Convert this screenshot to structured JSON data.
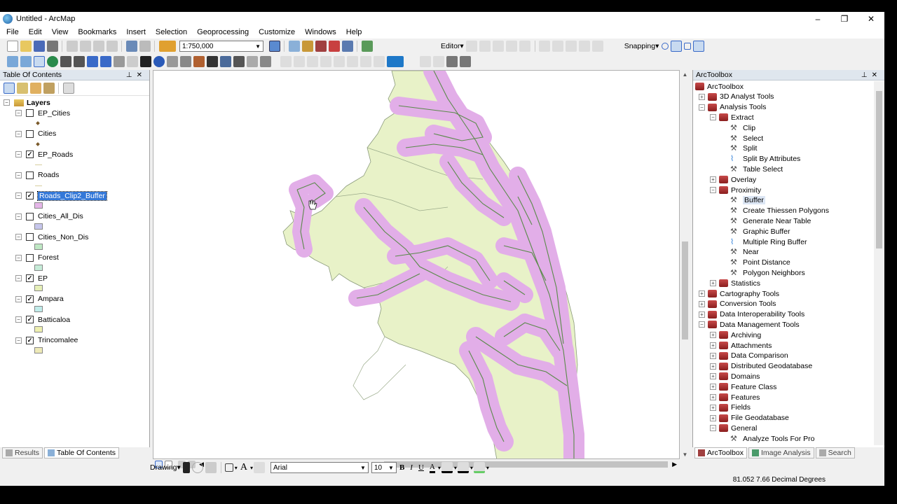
{
  "window": {
    "title": "Untitled - ArcMap",
    "minimize": "–",
    "maximize": "❐",
    "close": "✕"
  },
  "menu": [
    "File",
    "Edit",
    "View",
    "Bookmarks",
    "Insert",
    "Selection",
    "Geoprocessing",
    "Customize",
    "Windows",
    "Help"
  ],
  "toolbar": {
    "scale": "1:750,000",
    "editor": "Editor▾",
    "snapping": "Snapping▾"
  },
  "toc": {
    "title": "Table Of Contents",
    "root": "Layers",
    "layers": [
      {
        "name": "EP_Cities",
        "checked": false,
        "symbol": "point"
      },
      {
        "name": "Cities",
        "checked": false,
        "symbol": "point"
      },
      {
        "name": "EP_Roads",
        "checked": true,
        "symbol": "line"
      },
      {
        "name": "Roads",
        "checked": false,
        "symbol": "line"
      },
      {
        "name": "Roads_Clip2_Buffer",
        "checked": true,
        "symbol": "fill",
        "color": "#e5b6e8",
        "selected": true
      },
      {
        "name": "Cities_All_Dis",
        "checked": false,
        "symbol": "fill",
        "color": "#c6c6ec"
      },
      {
        "name": "Cities_Non_Dis",
        "checked": false,
        "symbol": "fill",
        "color": "#bfe8c4"
      },
      {
        "name": "Forest",
        "checked": false,
        "symbol": "fill",
        "color": "#c6ecd8"
      },
      {
        "name": "EP",
        "checked": true,
        "symbol": "fill",
        "color": "#e6f0b8"
      },
      {
        "name": "Ampara",
        "checked": true,
        "symbol": "fill",
        "color": "#c0ecea"
      },
      {
        "name": "Batticaloa",
        "checked": true,
        "symbol": "fill",
        "color": "#eef0b0"
      },
      {
        "name": "Trincomalee",
        "checked": true,
        "symbol": "fill",
        "color": "#eeeab8"
      }
    ]
  },
  "arctoolbox": {
    "title": "ArcToolbox",
    "nodes": [
      {
        "label": "ArcToolbox",
        "level": 0,
        "type": "root"
      },
      {
        "label": "3D Analyst Tools",
        "level": 1,
        "type": "toolbox",
        "expander": "+"
      },
      {
        "label": "Analysis Tools",
        "level": 1,
        "type": "toolbox",
        "expander": "−"
      },
      {
        "label": "Extract",
        "level": 2,
        "type": "toolset",
        "expander": "−"
      },
      {
        "label": "Clip",
        "level": 3,
        "type": "tool"
      },
      {
        "label": "Select",
        "level": 3,
        "type": "tool"
      },
      {
        "label": "Split",
        "level": 3,
        "type": "tool"
      },
      {
        "label": "Split By Attributes",
        "level": 3,
        "type": "script"
      },
      {
        "label": "Table Select",
        "level": 3,
        "type": "tool"
      },
      {
        "label": "Overlay",
        "level": 2,
        "type": "toolset",
        "expander": "+"
      },
      {
        "label": "Proximity",
        "level": 2,
        "type": "toolset",
        "expander": "−"
      },
      {
        "label": "Buffer",
        "level": 3,
        "type": "tool",
        "selected": true
      },
      {
        "label": "Create Thiessen Polygons",
        "level": 3,
        "type": "tool"
      },
      {
        "label": "Generate Near Table",
        "level": 3,
        "type": "tool"
      },
      {
        "label": "Graphic Buffer",
        "level": 3,
        "type": "tool"
      },
      {
        "label": "Multiple Ring Buffer",
        "level": 3,
        "type": "script"
      },
      {
        "label": "Near",
        "level": 3,
        "type": "tool"
      },
      {
        "label": "Point Distance",
        "level": 3,
        "type": "tool"
      },
      {
        "label": "Polygon Neighbors",
        "level": 3,
        "type": "tool"
      },
      {
        "label": "Statistics",
        "level": 2,
        "type": "toolset",
        "expander": "+"
      },
      {
        "label": "Cartography Tools",
        "level": 1,
        "type": "toolbox",
        "expander": "+"
      },
      {
        "label": "Conversion Tools",
        "level": 1,
        "type": "toolbox",
        "expander": "+"
      },
      {
        "label": "Data Interoperability Tools",
        "level": 1,
        "type": "toolbox",
        "expander": "+"
      },
      {
        "label": "Data Management Tools",
        "level": 1,
        "type": "toolbox",
        "expander": "−"
      },
      {
        "label": "Archiving",
        "level": 2,
        "type": "toolset",
        "expander": "+"
      },
      {
        "label": "Attachments",
        "level": 2,
        "type": "toolset",
        "expander": "+"
      },
      {
        "label": "Data Comparison",
        "level": 2,
        "type": "toolset",
        "expander": "+"
      },
      {
        "label": "Distributed Geodatabase",
        "level": 2,
        "type": "toolset",
        "expander": "+"
      },
      {
        "label": "Domains",
        "level": 2,
        "type": "toolset",
        "expander": "+"
      },
      {
        "label": "Feature Class",
        "level": 2,
        "type": "toolset",
        "expander": "+"
      },
      {
        "label": "Features",
        "level": 2,
        "type": "toolset",
        "expander": "+"
      },
      {
        "label": "Fields",
        "level": 2,
        "type": "toolset",
        "expander": "+"
      },
      {
        "label": "File Geodatabase",
        "level": 2,
        "type": "toolset",
        "expander": "+"
      },
      {
        "label": "General",
        "level": 2,
        "type": "toolset",
        "expander": "−"
      },
      {
        "label": "Analyze Tools For Pro",
        "level": 3,
        "type": "tool"
      }
    ]
  },
  "left_tabs": [
    "Results",
    "Table Of Contents"
  ],
  "right_tabs": [
    "ArcToolbox",
    "Image Analysis",
    "Search"
  ],
  "drawing": {
    "label": "Drawing▾",
    "font": "Arial",
    "size": "10",
    "bold": "B",
    "italic": "I",
    "underline": "U",
    "font_color": "A"
  },
  "status": {
    "coordinates": "81.052  7.66 Decimal Degrees"
  },
  "map": {
    "land_color": "#e8f2c8",
    "buffer_color": "#e2aee8",
    "road_color": "#5a8a4a"
  }
}
